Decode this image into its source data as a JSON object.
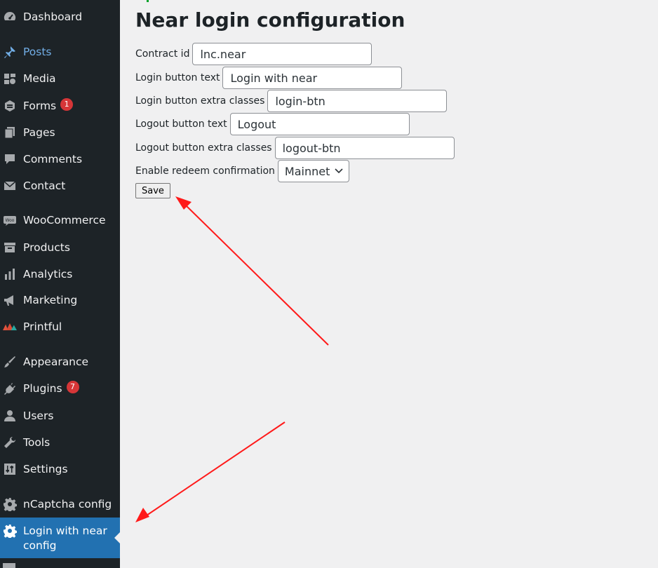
{
  "sidebar": {
    "items": [
      {
        "label": "Dashboard",
        "icon": "dashboard-icon"
      },
      {
        "label": "Posts",
        "icon": "pin-icon"
      },
      {
        "label": "Media",
        "icon": "media-icon"
      },
      {
        "label": "Forms",
        "icon": "forms-icon",
        "badge": "1"
      },
      {
        "label": "Pages",
        "icon": "pages-icon"
      },
      {
        "label": "Comments",
        "icon": "comments-icon"
      },
      {
        "label": "Contact",
        "icon": "mail-icon"
      },
      {
        "label": "WooCommerce",
        "icon": "woocommerce-icon"
      },
      {
        "label": "Products",
        "icon": "archive-icon"
      },
      {
        "label": "Analytics",
        "icon": "bar-chart-icon"
      },
      {
        "label": "Marketing",
        "icon": "megaphone-icon"
      },
      {
        "label": "Printful",
        "icon": "printful-logo-icon"
      },
      {
        "label": "Appearance",
        "icon": "brush-icon"
      },
      {
        "label": "Plugins",
        "icon": "plugin-icon",
        "badge": "7"
      },
      {
        "label": "Users",
        "icon": "user-icon"
      },
      {
        "label": "Tools",
        "icon": "wrench-icon"
      },
      {
        "label": "Settings",
        "icon": "sliders-icon"
      },
      {
        "label": "nCaptcha config",
        "icon": "gear-icon"
      },
      {
        "label": "Login with near config",
        "icon": "gear-icon"
      }
    ]
  },
  "main": {
    "title": "Near login configuration",
    "fields": {
      "contract_id": {
        "label": "Contract id",
        "value": "lnc.near"
      },
      "login_text": {
        "label": "Login button text",
        "value": "Login with near"
      },
      "login_classes": {
        "label": "Login button extra classes",
        "value": "login-btn"
      },
      "logout_text": {
        "label": "Logout button text",
        "value": "Logout"
      },
      "logout_classes": {
        "label": "Logout button extra classes",
        "value": "logout-btn"
      },
      "redeem": {
        "label": "Enable redeem confirmation",
        "value": "Mainnet"
      }
    },
    "save_label": "Save"
  },
  "colors": {
    "sidebar_bg": "#1d2327",
    "active_bg": "#2271b1",
    "badge": "#d63638",
    "annotation_arrow": "#ff0000"
  }
}
